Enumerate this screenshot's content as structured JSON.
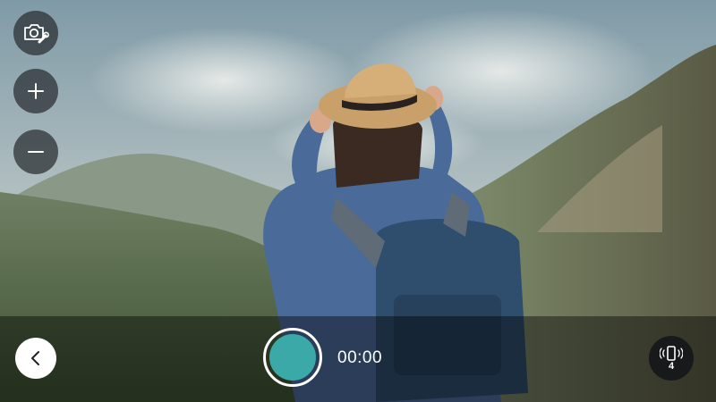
{
  "camera": {
    "timer": "00:00",
    "connected_devices": "4",
    "record_color": "#3aa9a8"
  },
  "icons": {
    "settings": "camera-settings-icon",
    "zoom_in": "plus-icon",
    "zoom_out": "minus-icon",
    "back": "chevron-left-icon",
    "devices": "phone-vibrate-icon"
  }
}
